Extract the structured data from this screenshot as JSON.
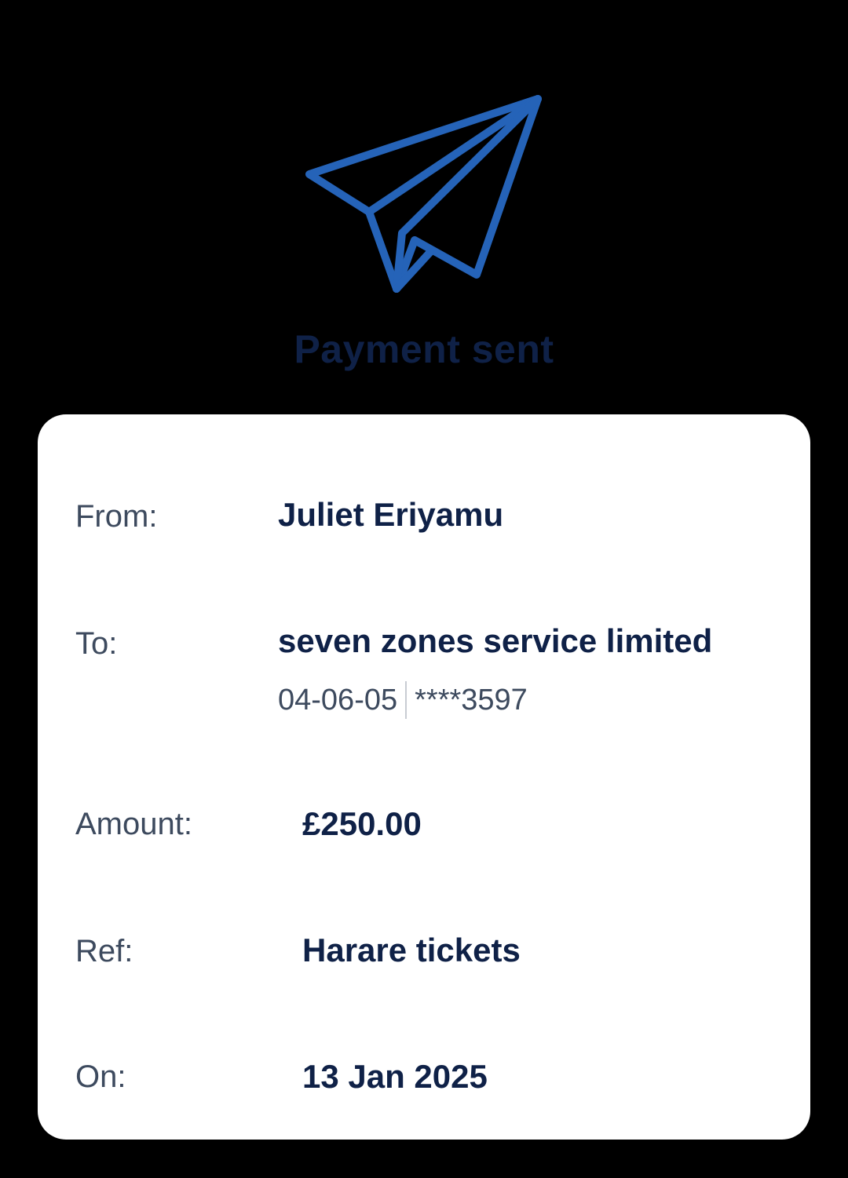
{
  "header": {
    "icon": "paper-plane-icon",
    "title": "Payment sent",
    "accent_color": "#2563b8"
  },
  "details": {
    "from_label": "From:",
    "from_value": "Juliet Eriyamu",
    "to_label": "To:",
    "to_value": "seven zones service limited",
    "sort_code": "04-06-05",
    "account_masked": "****3597",
    "amount_label": "Amount:",
    "amount_value": "£250.00",
    "ref_label": "Ref:",
    "ref_value": "Harare tickets",
    "on_label": "On:",
    "on_value": "13 Jan 2025"
  }
}
